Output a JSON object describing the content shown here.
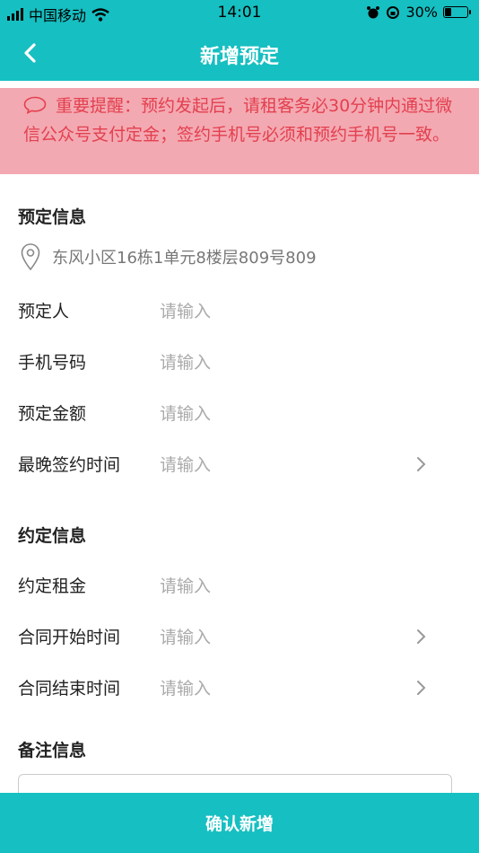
{
  "status_bar": {
    "carrier": "中国移动",
    "time": "14:01",
    "battery_text": "30%",
    "battery_level": 0.3
  },
  "header": {
    "title": "新增预定"
  },
  "notice": {
    "text": "重要提醒：预约发起后，请租客务必30分钟内通过微信公众号支付定金；签约手机号必须和预约手机号一致。"
  },
  "booking": {
    "section_title": "预定信息",
    "address": "东风小区16栋1单元8楼层809号809",
    "fields": [
      {
        "label": "预定人",
        "placeholder": "请输入"
      },
      {
        "label": "手机号码",
        "placeholder": "请输入"
      },
      {
        "label": "预定金额",
        "placeholder": "请输入"
      },
      {
        "label": "最晚签约时间",
        "placeholder": "请输入"
      }
    ]
  },
  "agreement": {
    "section_title": "约定信息",
    "fields": [
      {
        "label": "约定租金",
        "placeholder": "请输入"
      },
      {
        "label": "合同开始时间",
        "placeholder": "请输入"
      },
      {
        "label": "合同结束时间",
        "placeholder": "请输入"
      }
    ]
  },
  "remark": {
    "section_title": "备注信息"
  },
  "confirm_label": "确认新增",
  "colors": {
    "primary": "#16bfc1",
    "notice_bg": "#f3a9b2",
    "notice_text": "#e3404f"
  }
}
